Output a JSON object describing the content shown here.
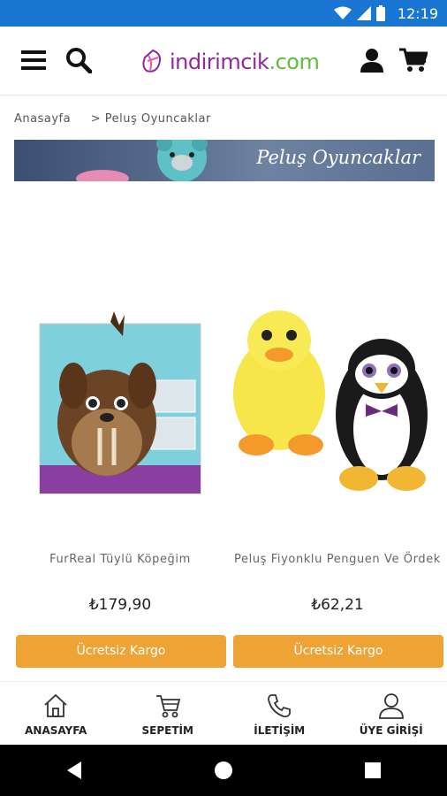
{
  "status_bar": {
    "time": "12:19"
  },
  "header": {
    "logo_text_main": "indirimcik",
    "logo_text_tld": ".com",
    "menu_icon": "hamburger-icon",
    "search_icon": "search-icon",
    "user_icon": "user-icon",
    "cart_icon": "cart-icon"
  },
  "breadcrumb": {
    "home": "Anasayfa",
    "current": "> Peluş Oyuncaklar"
  },
  "banner": {
    "title": "Peluş Oyuncaklar"
  },
  "products": [
    {
      "name": "FurReal Tüylü Köpeğim",
      "price": "₺179,90",
      "shipping": "Ücretsiz Kargo"
    },
    {
      "name": "Peluş Fiyonklu Penguen Ve Ördek",
      "price": "₺62,21",
      "shipping": "Ücretsiz Kargo"
    }
  ],
  "bottom_nav": [
    {
      "label": "ANASAYFA",
      "icon": "home-icon"
    },
    {
      "label": "SEPETİM",
      "icon": "cart-icon"
    },
    {
      "label": "İLETİŞİM",
      "icon": "phone-icon"
    },
    {
      "label": "ÜYE GİRİŞİ",
      "icon": "user-icon"
    }
  ],
  "colors": {
    "accent": "#f0a335",
    "brand": "#8e2a9e",
    "status_bar": "#1976d2"
  }
}
